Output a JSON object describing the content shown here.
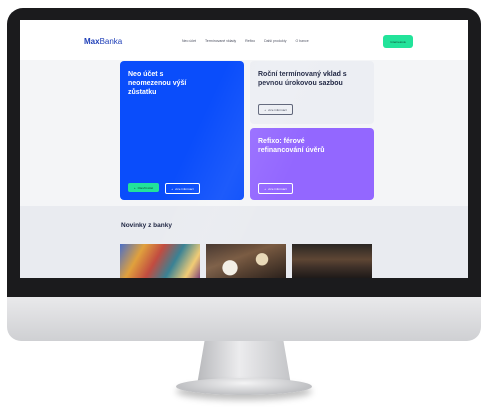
{
  "site": {
    "logo_bold": "Max",
    "logo_light": "Banka",
    "nav": [
      "Neo účet",
      "Termínované vklady",
      "Refixo",
      "Další produkty",
      "O bance"
    ],
    "cta_label": "Internetová"
  },
  "cards": {
    "blue": {
      "title": "Neo účet s neomezenou výší zůstatku",
      "primary_label": "Otevřít účet",
      "secondary_label": "více informací"
    },
    "grey": {
      "title": "Roční termínovaný vklad s pevnou úrokovou sazbou",
      "secondary_label": "více informací"
    },
    "purple": {
      "title": "Refixo: férové refinancování úvěrů",
      "secondary_label": "více informací"
    }
  },
  "news": {
    "title": "Novinky z banky"
  },
  "colors": {
    "brand_blue": "#0a4dfb",
    "accent_green": "#22e39a",
    "purple": "#9367ff"
  }
}
